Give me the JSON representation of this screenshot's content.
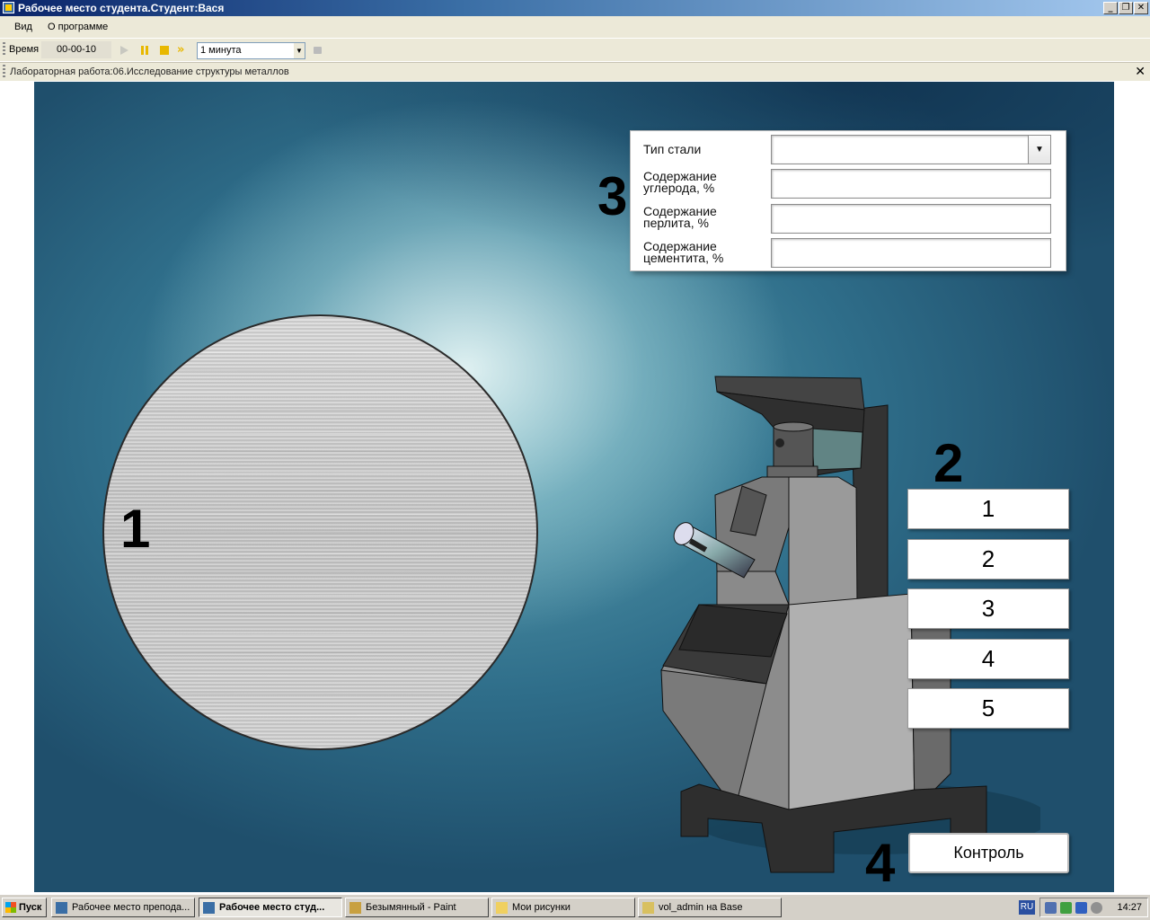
{
  "window": {
    "title": "Рабочее место студента.Студент:Вася"
  },
  "menu": {
    "items": [
      "Вид",
      "О программе"
    ]
  },
  "toolbar": {
    "time_label": "Время",
    "time_value": "00-00-10",
    "interval": "1 минута"
  },
  "lab": {
    "title": "Лабораторная работа:06.Исследование структуры металлов"
  },
  "markers": {
    "m1": "1",
    "m2": "2",
    "m3": "3",
    "m4": "4"
  },
  "form": {
    "steel_type_label": "Тип стали",
    "carbon_label": "Содержание углерода, %",
    "pearlite_label": "Содержание перлита, %",
    "cementite_label": "Содержание цементита, %"
  },
  "samples": [
    "1",
    "2",
    "3",
    "4",
    "5"
  ],
  "control_button": "Контроль",
  "taskbar": {
    "start": "Пуск",
    "tasks": [
      "Рабочее место препода...",
      "Рабочее место студ...",
      "Безымянный - Paint",
      "Мои рисунки",
      "vol_admin на Base"
    ],
    "lang": "RU",
    "clock": "14:27"
  },
  "colors": {
    "titlebar": "#0a246a",
    "chrome": "#ece9d8",
    "background_teal": "#2f6e8a"
  }
}
